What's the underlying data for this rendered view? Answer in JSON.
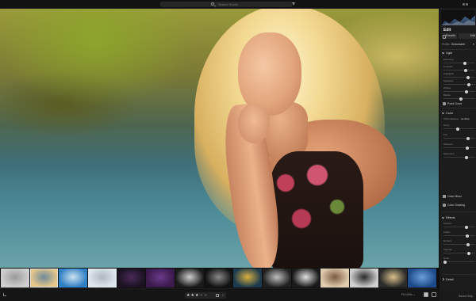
{
  "topbar": {
    "search_placeholder": "Search Studio"
  },
  "panel": {
    "title": "Edit",
    "presets_label": "Presets",
    "edit_label": "Edit",
    "profile_label": "Profile",
    "profile_value": "Embedded",
    "light": {
      "label": "Light",
      "sliders": [
        {
          "label": "Exposure",
          "value": 0.7
        },
        {
          "label": "Contrast",
          "value": 0.72
        },
        {
          "label": "Highlights",
          "value": 0.8
        },
        {
          "label": "Shadows",
          "value": 0.82
        },
        {
          "label": "Whites",
          "value": 0.75
        },
        {
          "label": "Blacks",
          "value": 0.55
        }
      ],
      "points_curve": "Point Curve"
    },
    "color": {
      "label": "Color",
      "white_balance_label": "White Balance",
      "white_balance_value": "As Shot",
      "sliders": [
        {
          "label": "Temp",
          "value": 0.45
        },
        {
          "label": "Tint",
          "value": 0.8
        },
        {
          "label": "Vibrance",
          "value": 0.78
        },
        {
          "label": "Saturation",
          "value": 0.76
        }
      ],
      "color_mixer": "Color Mixer",
      "color_grading": "Color Grading"
    },
    "effects": {
      "label": "Effects",
      "sliders": [
        {
          "label": "Texture",
          "value": 0.76
        },
        {
          "label": "Clarity",
          "value": 0.78
        },
        {
          "label": "Dehaze",
          "value": 0.8
        },
        {
          "label": "Vignette",
          "value": 0.82
        },
        {
          "label": "Grain",
          "value": 0.0
        }
      ]
    },
    "detail_label": "Detail",
    "bottom_label": "Saved Only"
  },
  "filmstrip": {
    "thumbs": [
      {
        "c1": "#cfcfcf",
        "c2": "#9a9a9a"
      },
      {
        "c1": "#e8c88a",
        "c2": "#6e8a9a"
      },
      {
        "c1": "#2f7fc4",
        "c2": "#cde2f0"
      },
      {
        "c1": "#dfe6ee",
        "c2": "#aeb7c2"
      },
      {
        "c1": "#1a1220",
        "c2": "#4a2a5a"
      },
      {
        "c1": "#3a1a4a",
        "c2": "#6a3a8a"
      },
      {
        "c1": "#1a1a1a",
        "c2": "#cfcfcf"
      },
      {
        "c1": "#111111",
        "c2": "#8a8a8a"
      },
      {
        "c1": "#1c3a4e",
        "c2": "#d8b040"
      },
      {
        "c1": "#202020",
        "c2": "#bfbfbf"
      },
      {
        "c1": "#1a1a1a",
        "c2": "#e0e0e0"
      },
      {
        "c1": "#e0ccb0",
        "c2": "#7a5a40"
      },
      {
        "c1": "#cfcfcf",
        "c2": "#2a2a2a"
      },
      {
        "c1": "#2a2a2a",
        "c2": "#d8c08a"
      },
      {
        "c1": "#1e4a8a",
        "c2": "#6aa0d8"
      }
    ],
    "selected_index": 1
  },
  "bottombar": {
    "stars_filled": 3,
    "stars_total": 5,
    "rating_suffix": "↑ 2",
    "zoom": "Fit  100%  ⌄"
  },
  "colors": {
    "background": "#161616",
    "panel": "#1c1c1c",
    "accent": "#e6e6e6"
  }
}
